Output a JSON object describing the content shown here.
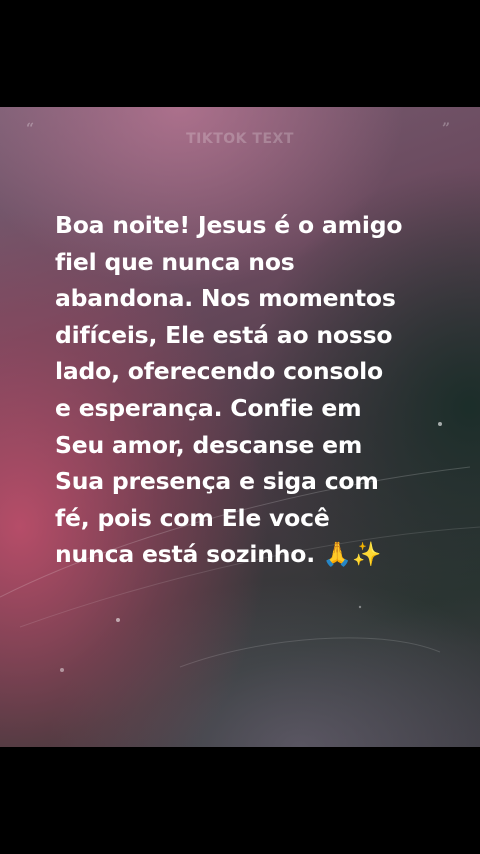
{
  "card": {
    "quote_open": "“",
    "quote_close": "”",
    "header_label": "TIKTOK TEXT",
    "message": "Boa noite! Jesus é o amigo\nfiel que nunca nos\nabandona. Nos momentos\ndifíceis, Ele está ao nosso\nlado, oferecendo consolo\ne esperança. Confie em\nSeu amor, descanse em\nSua presença e siga com\nfé, pois com Ele você\nnunca está sozinho. 🙏✨"
  },
  "colors": {
    "page_background": "#000000",
    "text": "#ffffff",
    "pink_glow": "#c8506e",
    "dark_green_glow": "#192d28"
  }
}
